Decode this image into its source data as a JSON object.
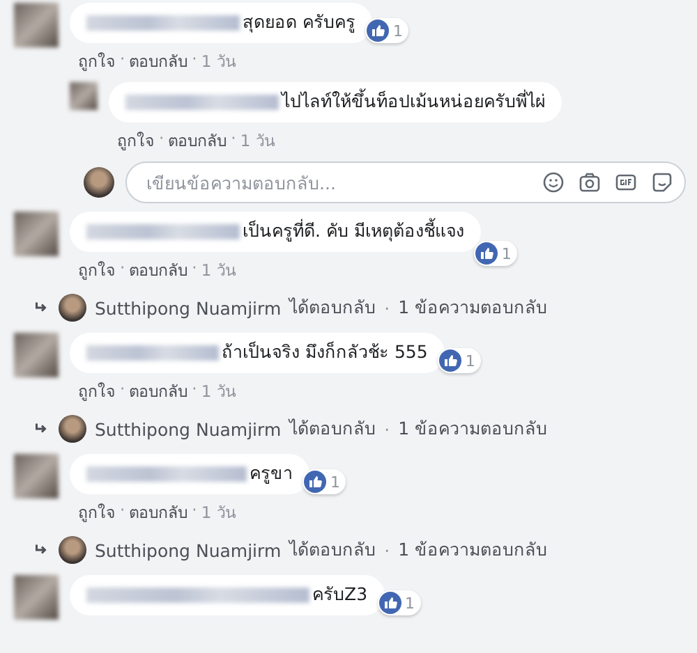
{
  "comments": [
    {
      "text": "สุดยอด ครับครู",
      "likes": "1",
      "actions": [
        {
          "kind": "link",
          "text": "ถูกใจ"
        },
        {
          "kind": "separator",
          "text": "·"
        },
        {
          "kind": "link",
          "text": "ตอบกลับ"
        },
        {
          "kind": "separator",
          "text": "·"
        },
        {
          "kind": "time",
          "text": "1 วัน"
        }
      ],
      "replies": [
        {
          "text": "ไปไลท์ให้ขึ้นท็อปเม้นหน่อยครับพี่ไผ่",
          "actions": [
            {
              "kind": "link",
              "text": "ถูกใจ"
            },
            {
              "kind": "separator",
              "text": "·"
            },
            {
              "kind": "link",
              "text": "ตอบกลับ"
            },
            {
              "kind": "separator",
              "text": "·"
            },
            {
              "kind": "time",
              "text": "1 วัน"
            }
          ]
        }
      ],
      "reply_box": {
        "placeholder": "เขียนข้อความตอบกลับ..."
      }
    },
    {
      "text": "เป็นครูที่ดี. คับ มีเหตุต้องชี้แจง",
      "likes": "1",
      "actions": [
        {
          "kind": "link",
          "text": "ถูกใจ"
        },
        {
          "kind": "separator",
          "text": "·"
        },
        {
          "kind": "link",
          "text": "ตอบกลับ"
        },
        {
          "kind": "separator",
          "text": "·"
        },
        {
          "kind": "time",
          "text": "1 วัน"
        }
      ],
      "reply_summary": {
        "name": "Sutthipong Nuamjirm",
        "verb": "ได้ตอบกลับ",
        "separator": "·",
        "count": "1 ข้อความตอบกลับ"
      }
    },
    {
      "text": "ถ้าเป็นจริง มึงก็กลัวช้ะ 555",
      "likes": "1",
      "actions": [
        {
          "kind": "link",
          "text": "ถูกใจ"
        },
        {
          "kind": "separator",
          "text": "·"
        },
        {
          "kind": "link",
          "text": "ตอบกลับ"
        },
        {
          "kind": "separator",
          "text": "·"
        },
        {
          "kind": "time",
          "text": "1 วัน"
        }
      ],
      "reply_summary": {
        "name": "Sutthipong Nuamjirm",
        "verb": "ได้ตอบกลับ",
        "separator": "·",
        "count": "1 ข้อความตอบกลับ"
      }
    },
    {
      "text": "ครูขา",
      "likes": "1",
      "actions": [
        {
          "kind": "link",
          "text": "ถูกใจ"
        },
        {
          "kind": "separator",
          "text": "·"
        },
        {
          "kind": "link",
          "text": "ตอบกลับ"
        },
        {
          "kind": "separator",
          "text": "·"
        },
        {
          "kind": "time",
          "text": "1 วัน"
        }
      ],
      "reply_summary": {
        "name": "Sutthipong Nuamjirm",
        "verb": "ได้ตอบกลับ",
        "separator": "·",
        "count": "1 ข้อความตอบกลับ"
      }
    },
    {
      "text": "ครับZ3",
      "likes": "1"
    }
  ]
}
